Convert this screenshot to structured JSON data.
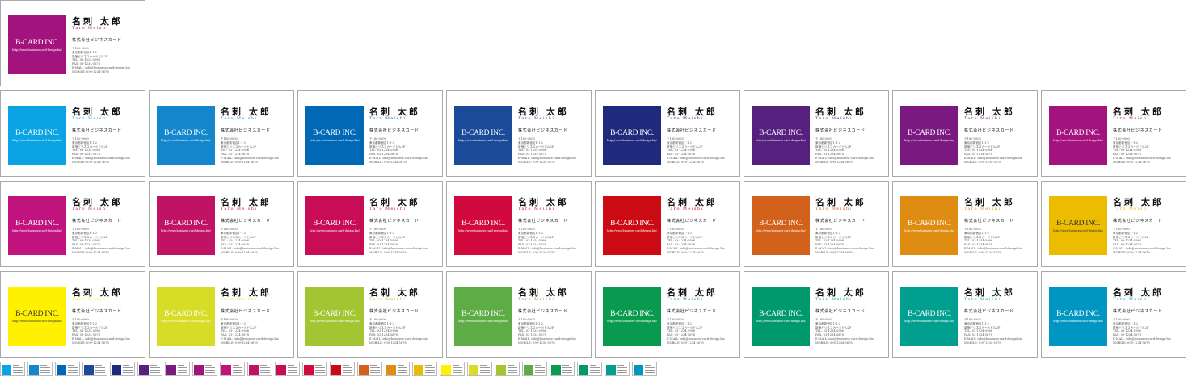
{
  "card": {
    "name": "名刺 太郎",
    "romaji": "Taro Meishi",
    "company": "株式会社ビジネスカード",
    "logo": "B-CARD INC.",
    "url": "http://www.business-card-design.biz/",
    "postal": "〒180-0000",
    "address1": "東京都新宿区1-1-2",
    "address2": "新宿ビジネスカードビル2F",
    "tel": "TEL: 03-1234-5986",
    "fax": "FAX: 03-1234-5678",
    "email": "E-MAIL: info@business-card-design.biz",
    "mobile": "MOBILE: 090-1234-5678"
  },
  "colors": [
    "#a3137e",
    "#0aa3e3",
    "#1386cc",
    "#0068b5",
    "#1b4a99",
    "#1f2a7c",
    "#56207f",
    "#7a1a81",
    "#a3137e",
    "#c1137e",
    "#c11366",
    "#c80c55",
    "#d1093c",
    "#cc0a14",
    "#d2611b",
    "#de8c12",
    "#ebbc00",
    "#fff100",
    "#d7dc26",
    "#a3c532",
    "#5eac46",
    "#089a4e",
    "#00996b",
    "#009f8f",
    "#0096c2"
  ]
}
